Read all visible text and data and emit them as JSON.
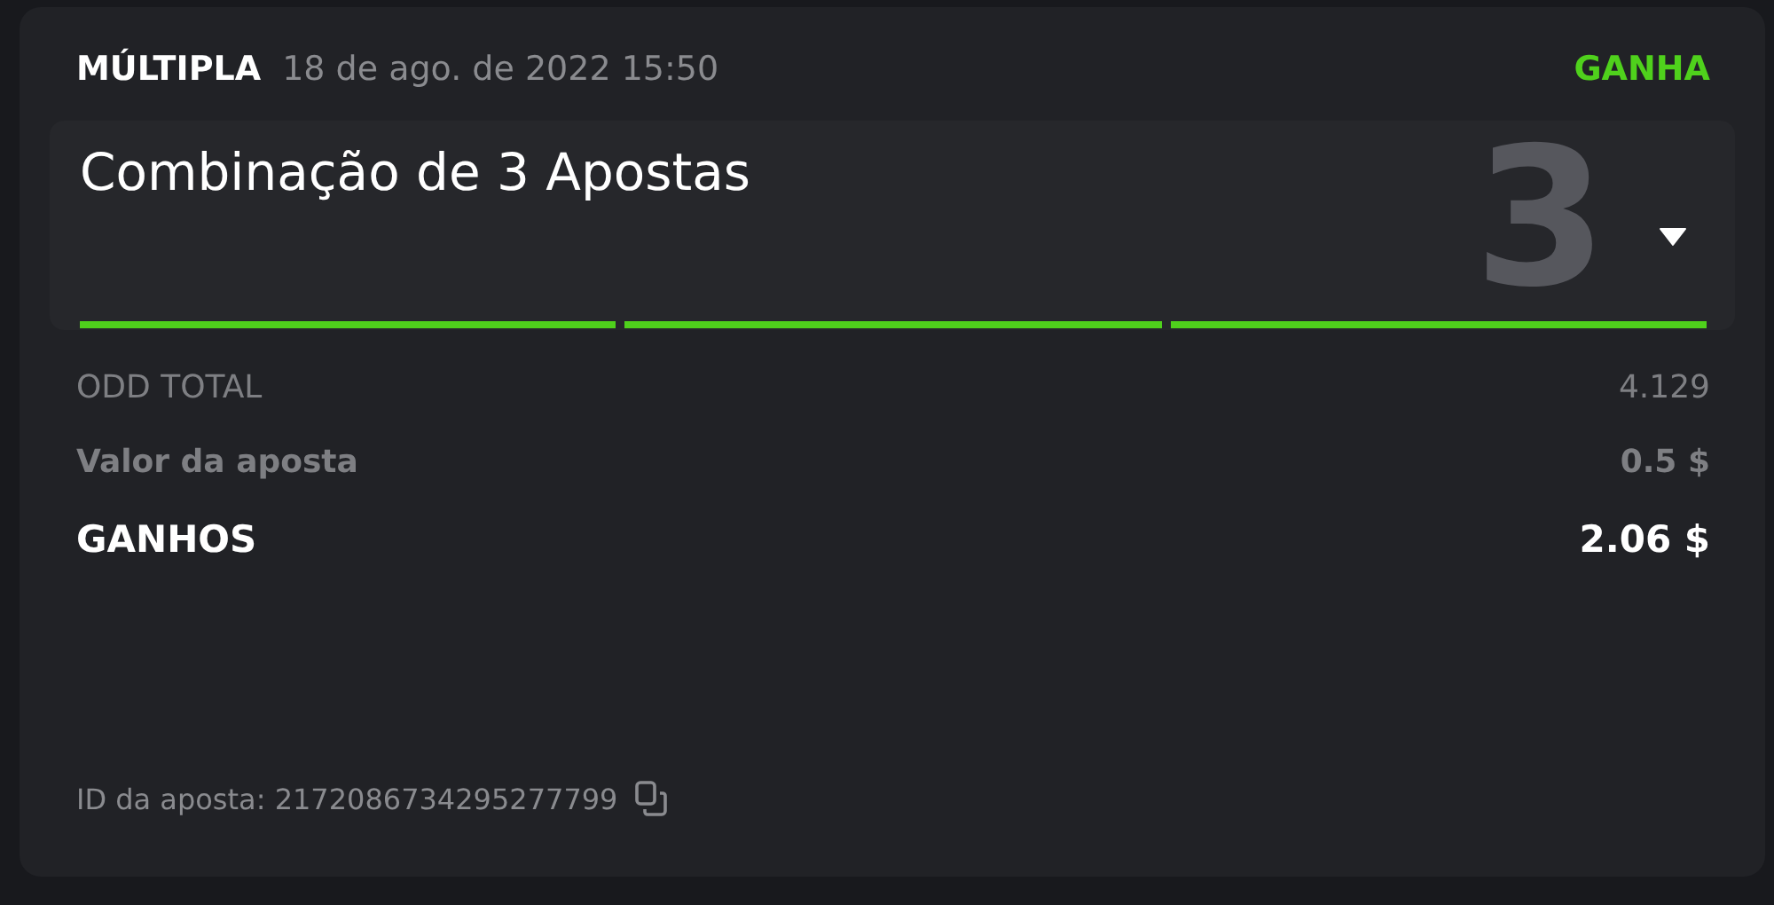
{
  "bet": {
    "type": "MÚLTIPLA",
    "date": "18 de ago. de 2022 15:50",
    "status": "GANHA",
    "won": true
  },
  "combo": {
    "title": "Combinação de 3 Apostas",
    "count": "3",
    "expanded": false,
    "legs": [
      {
        "won": true
      },
      {
        "won": true
      },
      {
        "won": true
      }
    ]
  },
  "summary": [
    {
      "kind": "muted",
      "label": "ODD TOTAL",
      "value": "4.129"
    },
    {
      "kind": "bold-muted",
      "label": "Valor da aposta",
      "value": "0.5 $"
    },
    {
      "kind": "strong",
      "label": "GANHOS",
      "value": "2.06 $"
    }
  ],
  "bet_id": "ID da aposta: 2172086734295277799"
}
